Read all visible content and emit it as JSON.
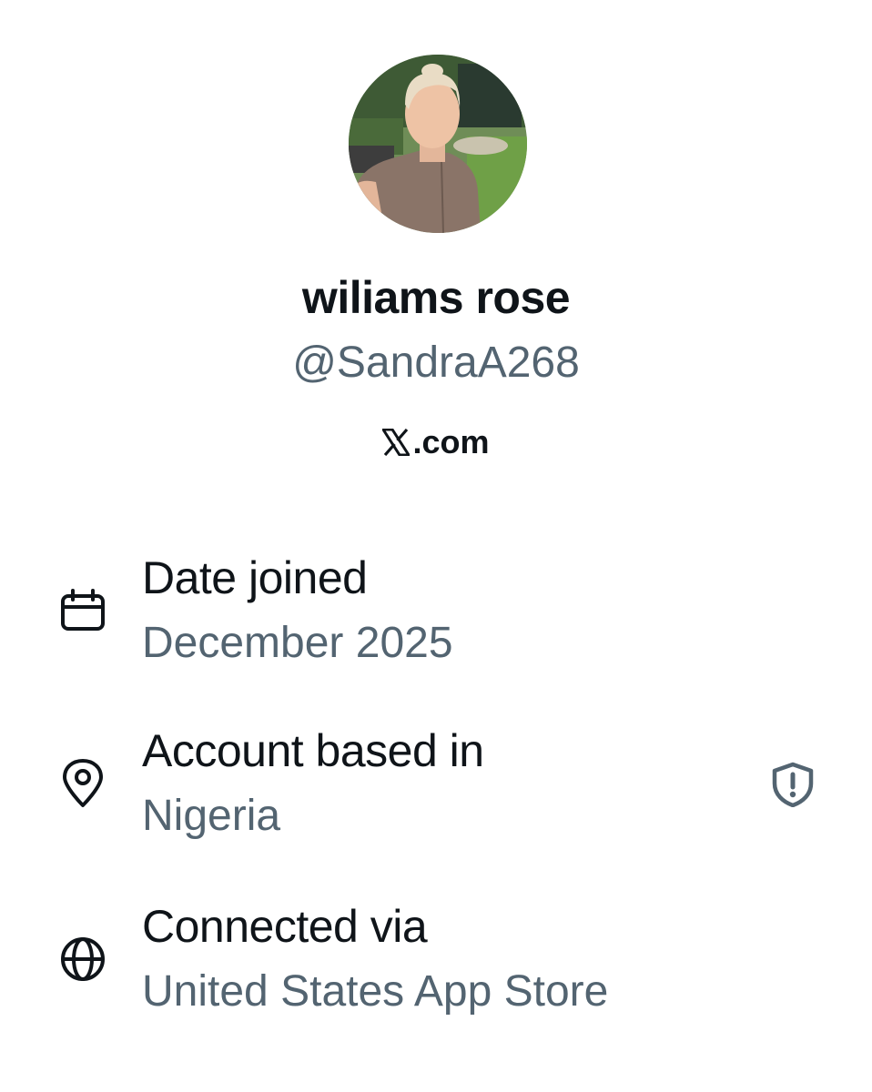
{
  "profile": {
    "display_name": "wiliams rose",
    "handle": "@SandraA268"
  },
  "brand": {
    "logo_icon": "x-logo-icon",
    "text": ".com"
  },
  "details": [
    {
      "icon": "calendar-icon",
      "label": "Date joined",
      "value": "December 2025"
    },
    {
      "icon": "location-pin-icon",
      "label": "Account based in",
      "value": "Nigeria"
    },
    {
      "icon": "globe-icon",
      "label": "Connected via",
      "value": "United States App Store"
    }
  ],
  "warning_icon": "shield-alert-icon",
  "colors": {
    "primary_text": "#0f1419",
    "secondary_text": "#536471",
    "background": "#ffffff"
  }
}
